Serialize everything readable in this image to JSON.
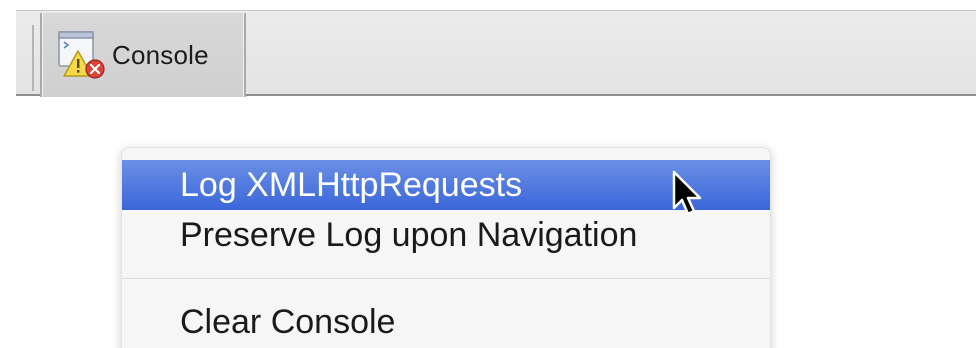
{
  "toolbar": {
    "console_button": {
      "label": "Console",
      "icon": "console-icon"
    }
  },
  "context_menu": {
    "items": [
      {
        "label": "Log XMLHttpRequests",
        "highlighted": true
      },
      {
        "label": "Preserve Log upon Navigation",
        "highlighted": false
      },
      {
        "label": "Clear Console",
        "highlighted": false
      }
    ]
  },
  "colors": {
    "highlight": "#3a66d8",
    "menu_background": "#f6f6f6",
    "toolbar_background": "#e3e3e3"
  }
}
